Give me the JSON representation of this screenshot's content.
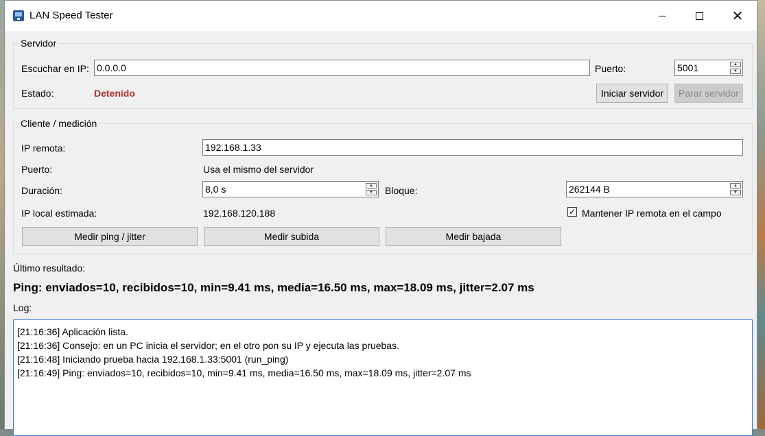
{
  "window": {
    "title": "LAN Speed Tester"
  },
  "server": {
    "group_title": "Servidor",
    "listen_label": "Escuchar en IP:",
    "listen_value": "0.0.0.0",
    "port_label": "Puerto:",
    "port_value": "5001",
    "status_label": "Estado:",
    "status_value": "Detenido",
    "status_color": "#b03030",
    "start_button": "Iniciar servidor",
    "stop_button": "Parar servidor"
  },
  "client": {
    "group_title": "Cliente / medición",
    "remote_ip_label": "IP remota:",
    "remote_ip_value": "192.168.1.33",
    "port_label": "Puerto:",
    "port_value": "Usa el mismo del servidor",
    "duration_label": "Duración:",
    "duration_value": "8,0 s",
    "block_label": "Bloque:",
    "block_value": "262144 B",
    "local_ip_label": "IP local estimada:",
    "local_ip_value": "192.168.120.188",
    "keep_ip_label": "Mantener IP remota en el campo",
    "keep_ip_checked": true,
    "ping_button": "Medir ping / jitter",
    "upload_button": "Medir subida",
    "download_button": "Medir bajada"
  },
  "result": {
    "label": "Último resultado:",
    "text": "Ping: enviados=10, recibidos=10, min=9.41 ms, media=16.50 ms, max=18.09 ms, jitter=2.07 ms"
  },
  "log": {
    "label": "Log:",
    "lines": [
      "[21:16:36] Aplicación lista.",
      "[21:16:36] Consejo: en un PC inicia el servidor; en el otro pon su IP y ejecuta las pruebas.",
      "[21:16:48] Iniciando prueba hacia 192.168.1.33:5001 (run_ping)",
      "[21:16:49] Ping: enviados=10, recibidos=10, min=9.41 ms, media=16.50 ms, max=18.09 ms, jitter=2.07 ms"
    ]
  }
}
